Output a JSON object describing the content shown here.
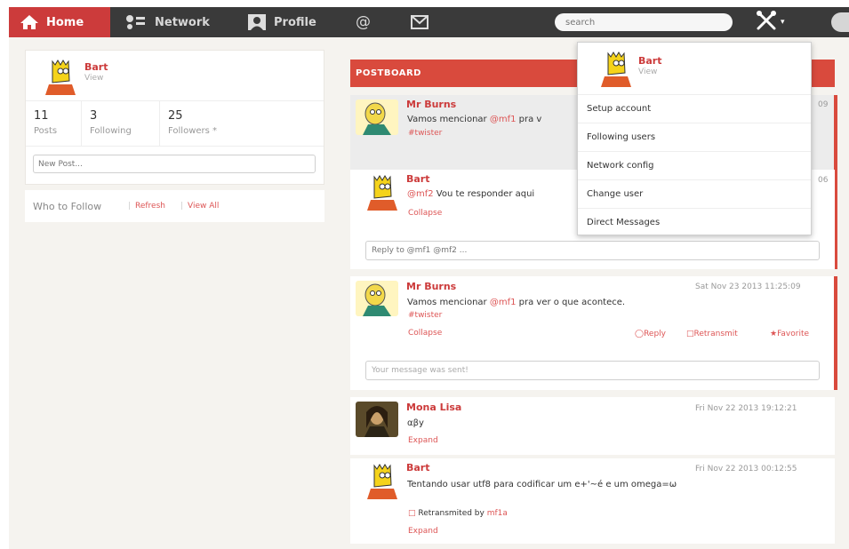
{
  "nav": {
    "home_label": "Home",
    "network_label": "Network",
    "profile_label": "Profile",
    "mentions_label": "@",
    "messages_icon": "envelope-icon",
    "search_placeholder": "search",
    "tools_icon": "tools-icon"
  },
  "colors": {
    "accent": "#d94a3d",
    "topbar": "#3a3a3a",
    "link": "#dd5555"
  },
  "profile": {
    "name": "Bart",
    "view": "View",
    "stats": [
      {
        "num": "11",
        "label": "Posts"
      },
      {
        "num": "3",
        "label": "Following"
      },
      {
        "num": "25",
        "label": "Followers *"
      }
    ],
    "new_post_placeholder": "New Post..."
  },
  "who_to_follow": {
    "title": "Who to Follow",
    "refresh": "Refresh",
    "view_all": "View All",
    "separator": "|"
  },
  "postboard": {
    "title": "POSTBOARD",
    "posts": [
      {
        "author": "Mr Burns",
        "time": "09",
        "text_before": "Vamos mencionar ",
        "mention": "@mf1",
        "text_after": " pra v",
        "hashtag": "#twister"
      },
      {
        "author": "Bart",
        "time": "06",
        "mention": "@mf2",
        "text": " Vou te responder aqui",
        "collapse": "Collapse",
        "reply_placeholder": "Reply to @mf1 @mf2 ..."
      },
      {
        "author": "Mr Burns",
        "time": "Sat Nov 23 2013 11:25:09",
        "text_before": "Vamos mencionar ",
        "mention": "@mf1",
        "text_after": " pra ver o que acontece.",
        "hashtag": "#twister",
        "collapse": "Collapse",
        "reply": "Reply",
        "retransmit": "Retransmit",
        "favorite": "★Favorite",
        "status_message": "Your message was sent!"
      },
      {
        "author": "Mona Lisa",
        "time": "Fri Nov 22 2013 19:12:21",
        "text": "αβy",
        "expand": "Expand"
      },
      {
        "author": "Bart",
        "time": "Fri Nov 22 2013 00:12:55",
        "text": "Tentando usar utf8 para codificar um e+'~é e um omega=ω",
        "retransmitted_by": "Retransmited by ",
        "retransmitted_user": "mf1a",
        "expand": "Expand"
      }
    ]
  },
  "dropdown": {
    "name": "Bart",
    "view": "View",
    "items": [
      "Setup account",
      "Following users",
      "Network config",
      "Change user",
      "Direct Messages"
    ]
  }
}
